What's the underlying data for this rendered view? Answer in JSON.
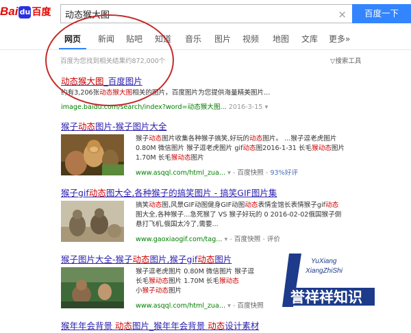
{
  "logo": {
    "bai": "Bai",
    "paw": "du",
    "du": "百度"
  },
  "search": {
    "query": "动态猴大图",
    "button": "百度一下",
    "clear": "×"
  },
  "tabs": [
    "网页",
    "新闻",
    "贴吧",
    "知道",
    "音乐",
    "图片",
    "视频",
    "地图",
    "文库",
    "更多»"
  ],
  "active_tab": "网页",
  "stats": "百度为您找到相关结果约872,000个",
  "tools": "搜索工具",
  "results": [
    {
      "title_pre": "动态猴大图",
      "title_post": "_百度图片",
      "line1_a": "约有3,206张",
      "line1_em": "动态猴大图",
      "line1_b": "相关的图片，百度图片为您提供海量精美图片...",
      "url": "image.baidu.com/search/index?word=动态猴大图...",
      "date": "2016-3-15"
    },
    {
      "title_a": "猴子",
      "title_em": "动态",
      "title_b": "图片-猴子图片大全",
      "lines": [
        [
          "猴子",
          "动态",
          "图片收集各种猴子搞笑,好玩的",
          "动态",
          "图片。 ...猴子逗老虎图片"
        ],
        [
          "0.80M 微信图片 猴子逗老虎图片 gif",
          "动态",
          "图2016-1-31 长毛",
          "猴动态",
          "图片"
        ],
        [
          "1.70M 长毛",
          "猴动态",
          "图片",
          "",
          ""
        ]
      ],
      "url": "www.asqql.com/html_zua...",
      "snapshot": "百度快照",
      "rating": "93%好评"
    },
    {
      "title_a": "猴子gif",
      "title_em": "动态",
      "title_b": "图大全,各种猴子的搞笑图片 - 搞笑GIF图片集",
      "lines": [
        [
          "搞笑",
          "动态",
          "图,风景GIF动图健身GIF动图",
          "动态",
          "表情金馆长表情猴子gif",
          "动态"
        ],
        [
          "图大全,各种猴子...急死猴了 VS 猴子好玩的 0 2016-02-02俄国猴子倒",
          "",
          "",
          "",
          "",
          ""
        ],
        [
          "悬打飞机,俄国太冷了,需要...",
          "",
          "",
          "",
          "",
          ""
        ]
      ],
      "url": "www.gaoxiaogif.com/tag...",
      "snapshot": "百度快照",
      "rating": "评价"
    },
    {
      "title_a": "猴子图片大全-猴子",
      "title_em": "动态",
      "title_b": "图片,猴子gif",
      "title_em2": "动态",
      "title_c": "图片",
      "lines": [
        [
          "猴子逗老虎图片 0.80M 微信图片 猴子逗",
          "",
          ""
        ],
        [
          "长毛",
          "猴动态",
          "图片 1.70M 长毛",
          "猴动态",
          ""
        ],
        [
          "小",
          "猴子动态",
          "图片 ",
          "",
          ""
        ]
      ],
      "url": "www.asqql.com/html_zua...",
      "snapshot": "百度快照"
    },
    {
      "title_a": "猴年年会背景 ",
      "title_em": "动态",
      "title_b": "图片_猴年年会背景 ",
      "title_em2": "动态",
      "title_c": "设计素材"
    }
  ],
  "watermark": {
    "line1": "YuXiang",
    "line2": "XiangZhiShi",
    "main": "誉祥祥知识"
  },
  "colors": {
    "accent": "#3385ff",
    "link": "#2a1fad",
    "highlight": "#c00000",
    "url": "#008000",
    "annotation": "#c42a2a"
  }
}
